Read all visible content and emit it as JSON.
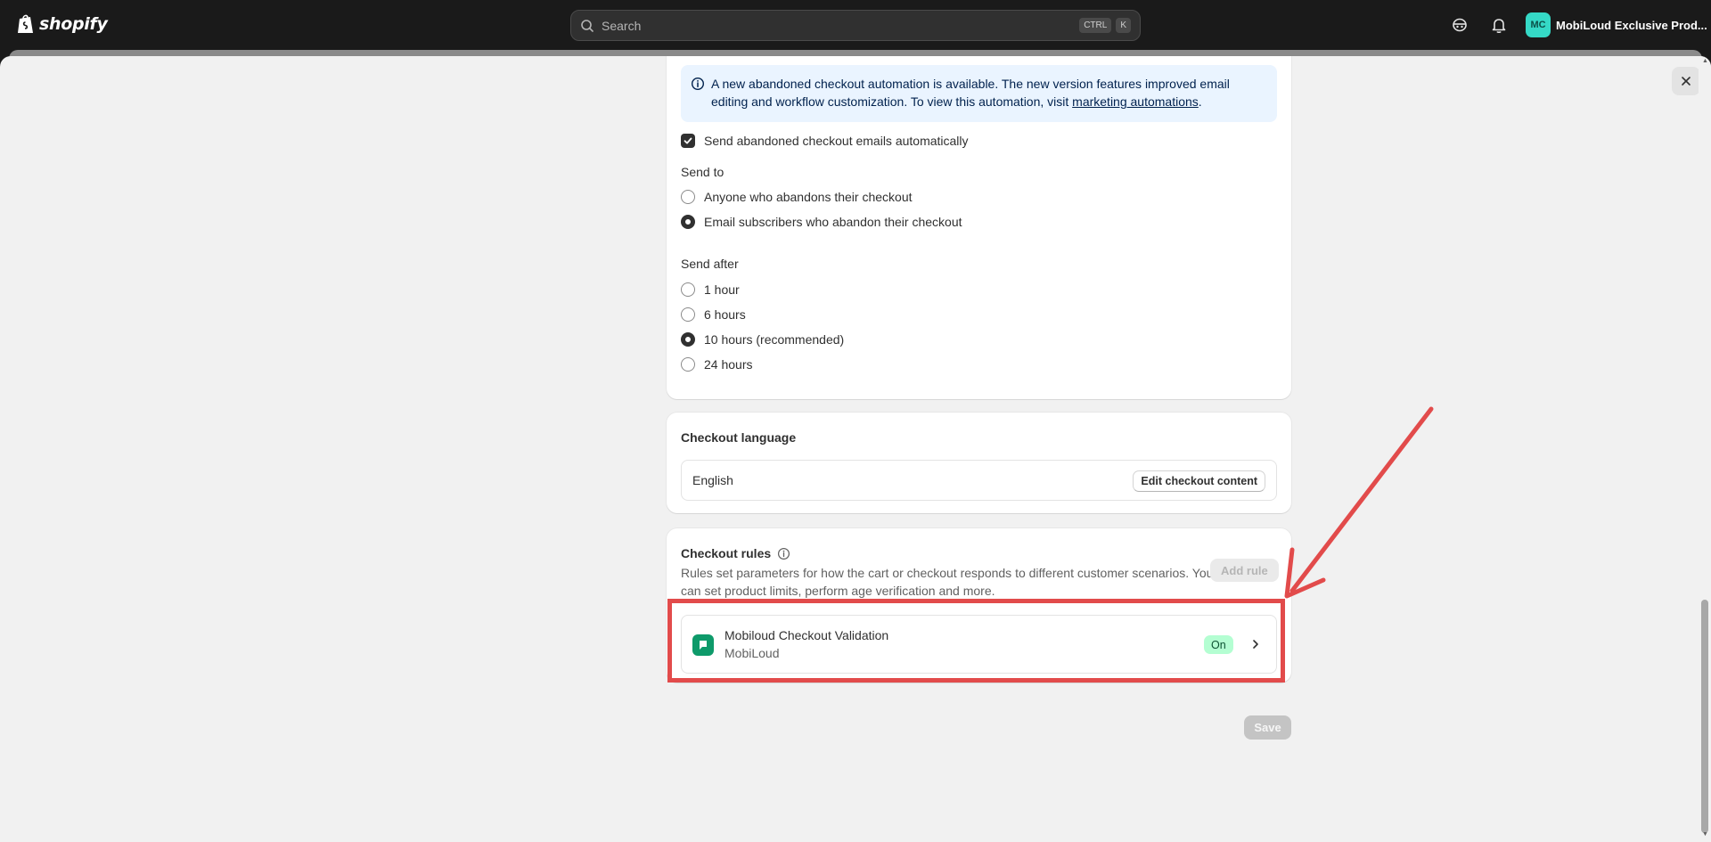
{
  "topbar": {
    "brand": "shopify",
    "search_placeholder": "Search",
    "shortcut_keys": [
      "CTRL",
      "K"
    ],
    "icons": [
      "store-status-icon",
      "bell-icon"
    ],
    "avatar_initials": "MC",
    "account_name": "MobiLoud Exclusive Prod..."
  },
  "banner": {
    "text_before_link": "A new abandoned checkout automation is available. The new version features improved email editing and workflow customization. To view this automation, visit ",
    "link_text": "marketing automations",
    "text_after_link": "."
  },
  "abandoned": {
    "auto_send_label": "Send abandoned checkout emails automatically",
    "auto_send_checked": true,
    "send_to_heading": "Send to",
    "send_to_options": [
      {
        "label": "Anyone who abandons their checkout",
        "selected": false
      },
      {
        "label": "Email subscribers who abandon their checkout",
        "selected": true
      }
    ],
    "send_after_heading": "Send after",
    "send_after_options": [
      {
        "label": "1 hour",
        "selected": false
      },
      {
        "label": "6 hours",
        "selected": false
      },
      {
        "label": "10 hours (recommended)",
        "selected": true
      },
      {
        "label": "24 hours",
        "selected": false
      }
    ]
  },
  "checkout_language": {
    "heading": "Checkout language",
    "language": "English",
    "edit_button": "Edit checkout content"
  },
  "checkout_rules": {
    "heading": "Checkout rules",
    "description": "Rules set parameters for how the cart or checkout responds to different customer scenarios. You can set product limits, perform age verification and more.",
    "add_button": "Add rule",
    "rule": {
      "name": "Mobiloud Checkout Validation",
      "vendor": "MobiLoud",
      "status": "On"
    }
  },
  "footer": {
    "save_button": "Save"
  },
  "colors": {
    "annotation_red": "#e24b4b",
    "status_on_bg": "#b4fed2",
    "app_icon_green": "#0e9a6a"
  }
}
